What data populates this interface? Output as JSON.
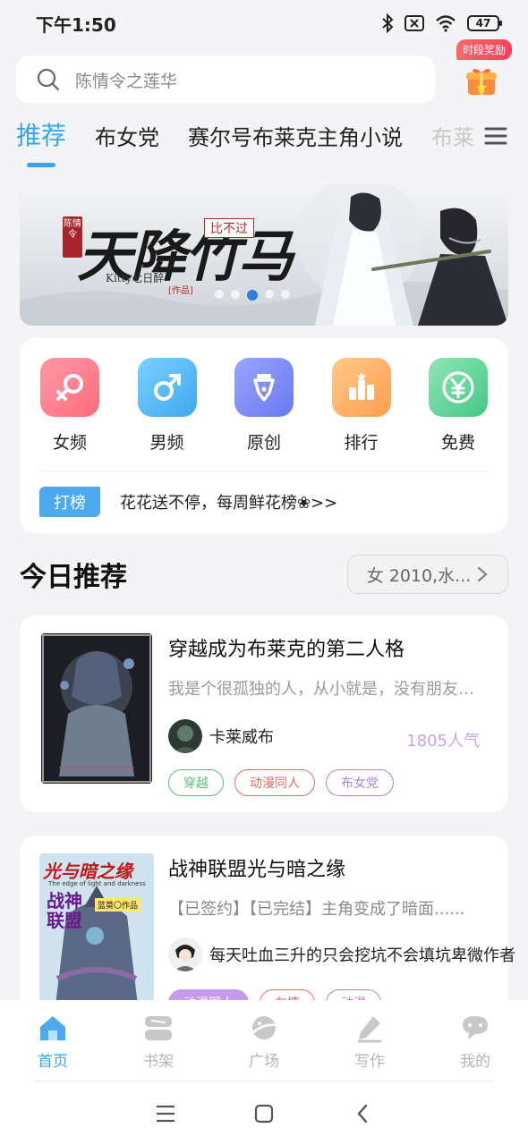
{
  "status": {
    "time": "下午1:50",
    "battery": "47"
  },
  "search": {
    "placeholder": "陈情令之莲华"
  },
  "reward": {
    "badge": "时段奖励"
  },
  "tabs": [
    {
      "label": "推荐"
    },
    {
      "label": "布女党"
    },
    {
      "label": "赛尔号布莱克主角小说"
    },
    {
      "label": "布莱"
    }
  ],
  "banner": {
    "title": "天降竹马",
    "tag_small": "陈情令",
    "subtitle": "比不过",
    "author": "Kitty七日醉",
    "works": "[作品]"
  },
  "categories": [
    {
      "label": "女频",
      "icon": "female-icon",
      "color": "#ff7b8a"
    },
    {
      "label": "男频",
      "icon": "male-icon",
      "color": "#4fb7f5"
    },
    {
      "label": "原创",
      "icon": "pen-nib-icon",
      "color": "#7e8cf5"
    },
    {
      "label": "排行",
      "icon": "ranking-icon",
      "color": "#ffb065"
    },
    {
      "label": "免费",
      "icon": "yen-icon",
      "color": "#5ed49a"
    }
  ],
  "rank": {
    "tag": "打榜",
    "text": "花花送不停，每周鲜花榜❀>>"
  },
  "today": {
    "title": "今日推荐",
    "filter": "女 2010,水..."
  },
  "books": [
    {
      "title": "穿越成为布莱克的第二人格",
      "desc": "我是个很孤独的人，从小就是，没有朋友，没有亲人",
      "author": "卡莱威布",
      "popularity": "1805人气",
      "tags": [
        {
          "label": "穿越",
          "color": "#5cbf7a"
        },
        {
          "label": "动漫同人",
          "color": "#e86a6a"
        },
        {
          "label": "布女党",
          "color": "#b27fe0"
        }
      ]
    },
    {
      "title": "战神联盟光与暗之缘",
      "desc": "【已签约】【已完结】主角变成了暗面......",
      "author": "每天吐血三升的只会挖坑不会填坑卑微作者",
      "cover_title": "光与暗之缘",
      "cover_sub": "The edge of light and darkness",
      "cover_author": "蓝莫〇作品",
      "cover_big": "战神联盟",
      "tags": [
        {
          "label": "动漫同人",
          "color": "#b27fe0"
        },
        {
          "label": "友情",
          "color": "#e86a6a"
        },
        {
          "label": "动漫",
          "color": "#b27fe0"
        }
      ]
    }
  ],
  "nav": [
    {
      "label": "首页",
      "icon": "home-icon"
    },
    {
      "label": "书架",
      "icon": "bookshelf-icon"
    },
    {
      "label": "广场",
      "icon": "planet-icon"
    },
    {
      "label": "写作",
      "icon": "write-icon"
    },
    {
      "label": "我的",
      "icon": "profile-icon"
    }
  ]
}
